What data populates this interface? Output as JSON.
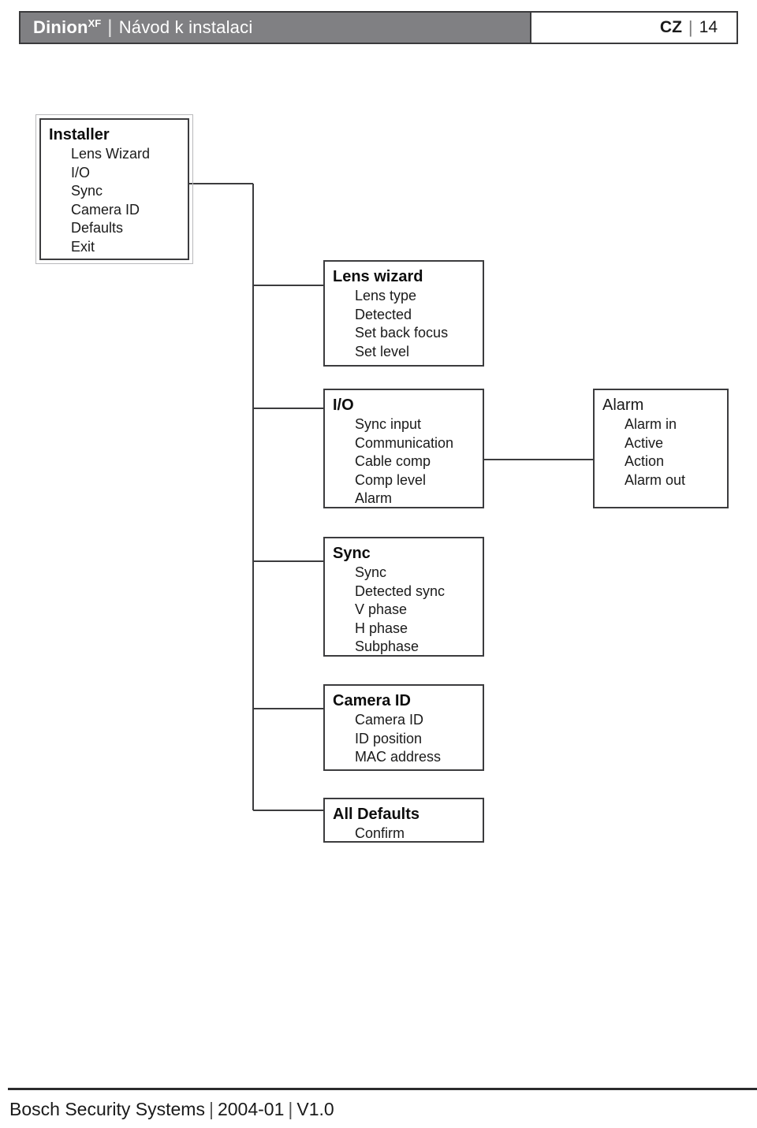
{
  "header": {
    "brand": "Dinion",
    "brand_superscript": "XF",
    "separator": "|",
    "subtitle": "Návod k instalaci",
    "language_code": "CZ",
    "page_number": "14",
    "bar_color": "#808083",
    "border_color": "#3a3a3c"
  },
  "diagram": {
    "type": "menu-tree",
    "line_color": "#3c3c3e",
    "boxes": [
      {
        "id": "installer",
        "title": "Installer",
        "title_bold": true,
        "items": [
          "Lens Wizard",
          "I/O",
          "Sync",
          "Camera ID",
          "Defaults",
          "Exit"
        ]
      },
      {
        "id": "lens-wizard",
        "title": "Lens wizard",
        "title_bold": true,
        "items": [
          "Lens type",
          "Detected",
          "Set back focus",
          "Set level"
        ]
      },
      {
        "id": "io",
        "title": "I/O",
        "title_bold": true,
        "items": [
          "Sync input",
          "Communication",
          "Cable comp",
          "Comp level",
          "Alarm"
        ]
      },
      {
        "id": "alarm",
        "title": "Alarm",
        "title_bold": false,
        "items": [
          "Alarm in",
          "Active",
          "Action",
          "Alarm out"
        ]
      },
      {
        "id": "sync",
        "title": "Sync",
        "title_bold": true,
        "items": [
          "Sync",
          "Detected sync",
          "V phase",
          "H phase",
          "Subphase"
        ]
      },
      {
        "id": "camera-id",
        "title": "Camera ID",
        "title_bold": true,
        "items": [
          "Camera ID",
          "ID position",
          "MAC address"
        ]
      },
      {
        "id": "all-defaults",
        "title": "All Defaults",
        "title_bold": true,
        "items": [
          "Confirm"
        ]
      }
    ]
  },
  "footer": {
    "company": "Bosch Security Systems",
    "separator": "|",
    "date": "2004-01",
    "version": "V1.0"
  }
}
